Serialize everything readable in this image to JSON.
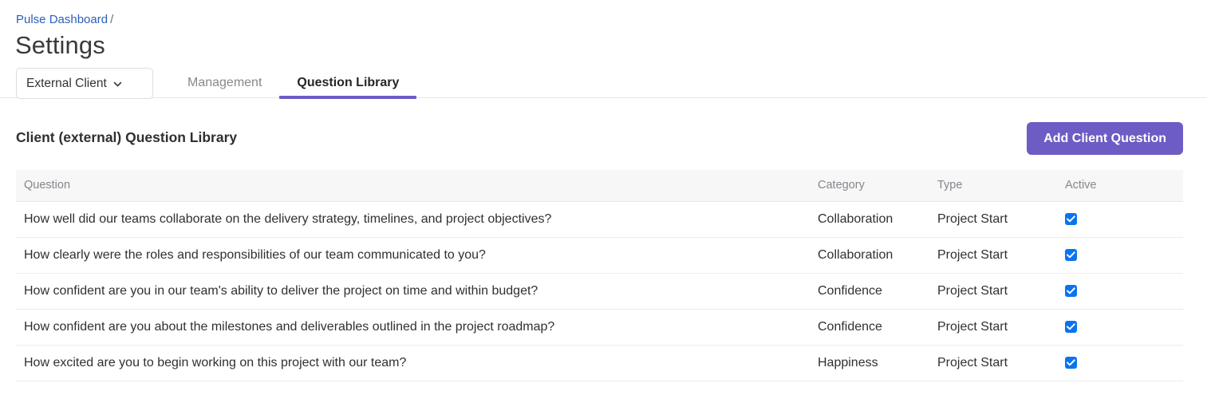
{
  "breadcrumb": {
    "parent": "Pulse Dashboard",
    "separator": "/"
  },
  "page_title": "Settings",
  "scope_select": {
    "value": "External Client",
    "icon": "chevron-down-icon"
  },
  "tabs": [
    {
      "label": "Management",
      "active": false
    },
    {
      "label": "Question Library",
      "active": true
    }
  ],
  "section": {
    "title": "Client (external) Question Library",
    "add_button_label": "Add Client Question"
  },
  "table": {
    "columns": [
      "Question",
      "Category",
      "Type",
      "Active"
    ],
    "rows": [
      {
        "question": "How well did our teams collaborate on the delivery strategy, timelines, and project objectives?",
        "category": "Collaboration",
        "type": "Project Start",
        "active": true
      },
      {
        "question": "How clearly were the roles and responsibilities of our team communicated to you?",
        "category": "Collaboration",
        "type": "Project Start",
        "active": true
      },
      {
        "question": "How confident are you in our team's ability to deliver the project on time and within budget?",
        "category": "Confidence",
        "type": "Project Start",
        "active": true
      },
      {
        "question": "How confident are you about the milestones and deliverables outlined in the project roadmap?",
        "category": "Confidence",
        "type": "Project Start",
        "active": true
      },
      {
        "question": "How excited are you to begin working on this project with our team?",
        "category": "Happiness",
        "type": "Project Start",
        "active": true
      }
    ]
  },
  "colors": {
    "accent_purple": "#6c5cc4",
    "link_blue": "#2b5fb8",
    "checkbox_blue": "#0a74f0",
    "header_bg": "#f7f7f8",
    "border": "#e7e7ea"
  }
}
